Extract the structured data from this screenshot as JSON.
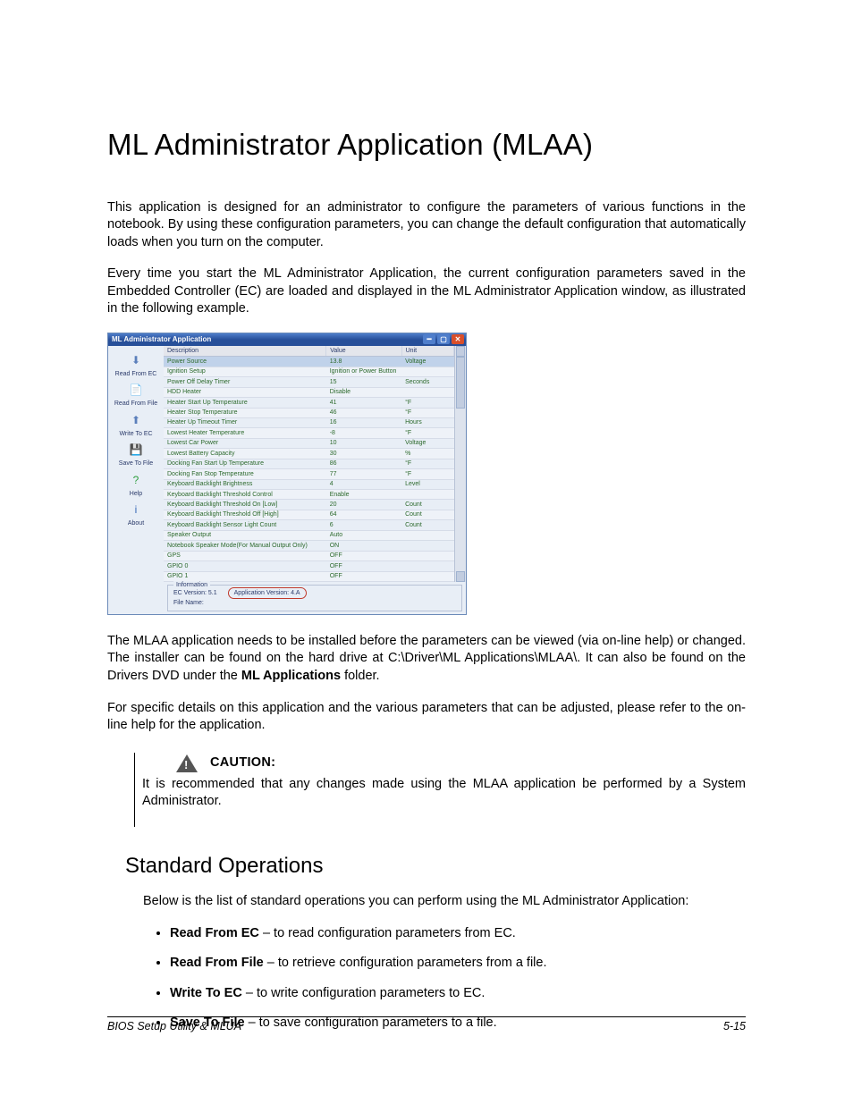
{
  "heading": "ML Administrator Application (MLAA)",
  "para1": "This application is designed for an administrator to configure the parameters of various functions in the notebook. By using these configuration parameters, you can change the default configuration that automatically loads when you turn on the computer.",
  "para2": "Every time you start the ML Administrator Application, the current configuration parameters saved in the Embedded Controller (EC) are loaded and displayed in the ML Administrator Application window, as illustrated in the following example.",
  "screenshot": {
    "title": "ML Administrator Application",
    "sidebar": [
      {
        "label": "Read From EC",
        "icon": "⬇"
      },
      {
        "label": "Read From File",
        "icon": "📄"
      },
      {
        "label": "Write To EC",
        "icon": "⬆"
      },
      {
        "label": "Save To File",
        "icon": "💾"
      },
      {
        "label": "Help",
        "icon": "?"
      },
      {
        "label": "About",
        "icon": "i"
      }
    ],
    "columns": {
      "c0": "Description",
      "c1": "Value",
      "c2": "Unit"
    },
    "rows": [
      {
        "d": "Power Source",
        "v": "13.8",
        "u": "Voltage",
        "sel": true
      },
      {
        "d": "Ignition Setup",
        "v": "Ignition or Power Button",
        "u": ""
      },
      {
        "d": "Power Off Delay Timer",
        "v": "15",
        "u": "Seconds"
      },
      {
        "d": "HDD Heater",
        "v": "Disable",
        "u": ""
      },
      {
        "d": "Heater Start Up Temperature",
        "v": "41",
        "u": "°F"
      },
      {
        "d": "Heater Stop Temperature",
        "v": "46",
        "u": "°F"
      },
      {
        "d": "Heater Up Timeout Timer",
        "v": "16",
        "u": "Hours"
      },
      {
        "d": "Lowest Heater Temperature",
        "v": "-8",
        "u": "°F"
      },
      {
        "d": "Lowest Car Power",
        "v": "10",
        "u": "Voltage"
      },
      {
        "d": "Lowest Battery Capacity",
        "v": "30",
        "u": "%"
      },
      {
        "d": "Docking Fan Start Up Temperature",
        "v": "86",
        "u": "°F"
      },
      {
        "d": "Docking Fan Stop Temperature",
        "v": "77",
        "u": "°F"
      },
      {
        "d": "Keyboard Backlight Brightness",
        "v": "4",
        "u": "Level"
      },
      {
        "d": "Keyboard Backlight Threshold Control",
        "v": "Enable",
        "u": ""
      },
      {
        "d": "Keyboard Backlight Threshold On [Low]",
        "v": "20",
        "u": "Count"
      },
      {
        "d": "Keyboard Backlight Threshold Off [High]",
        "v": "64",
        "u": "Count"
      },
      {
        "d": "Keyboard Backlight Sensor Light Count",
        "v": "6",
        "u": "Count"
      },
      {
        "d": "Speaker Output",
        "v": "Auto",
        "u": ""
      },
      {
        "d": "Notebook Speaker Mode(For Manual Output Only)",
        "v": "ON",
        "u": ""
      },
      {
        "d": "GPS",
        "v": "OFF",
        "u": ""
      },
      {
        "d": "GPIO 0",
        "v": "OFF",
        "u": ""
      },
      {
        "d": "GPIO 1",
        "v": "OFF",
        "u": ""
      }
    ],
    "info": {
      "legend": "Information",
      "ec": "EC Version: 5.1",
      "app": "Application Version: 4.A",
      "file": "File Name:"
    }
  },
  "para3a": "The MLAA application needs to be installed before the parameters can be viewed (via on-line help) or changed.  The installer can be found on the hard drive at C:\\Driver\\ML Applications\\MLAA\\.  It can also be found on the Drivers DVD under the ",
  "para3b": "ML Applications",
  "para3c": " folder.",
  "para4": "For specific details on this application and the various parameters that can be adjusted, please refer to the on-line help for the application.",
  "caution_label": "CAUTION:",
  "caution_text": "It is recommended that any changes made using the MLAA application be performed by a System Administrator.",
  "subheading": "Standard Operations",
  "ops_intro": "Below is the list of standard operations you can perform using the ML Administrator Application:",
  "ops": [
    {
      "name": "Read From EC",
      "desc": " – to read configuration parameters from EC."
    },
    {
      "name": "Read From File",
      "desc": " – to retrieve configuration parameters from a file."
    },
    {
      "name": "Write To EC",
      "desc": " – to write configuration parameters to EC."
    },
    {
      "name": "Save To File",
      "desc": " – to save configuration parameters to a file."
    }
  ],
  "footer_left": "BIOS Setup Utility & MLUA",
  "footer_right": "5-15"
}
